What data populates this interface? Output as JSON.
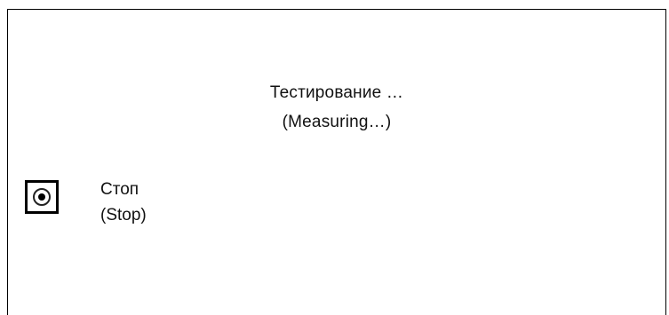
{
  "status": {
    "title_ru": "Тестирование …",
    "title_en": "(Measuring…)"
  },
  "stop_control": {
    "icon": "radio-button-icon",
    "label_ru": "Стоп",
    "label_en": "(Stop)"
  },
  "colors": {
    "background": "#ffffff",
    "border": "#000000",
    "text": "#111111"
  }
}
